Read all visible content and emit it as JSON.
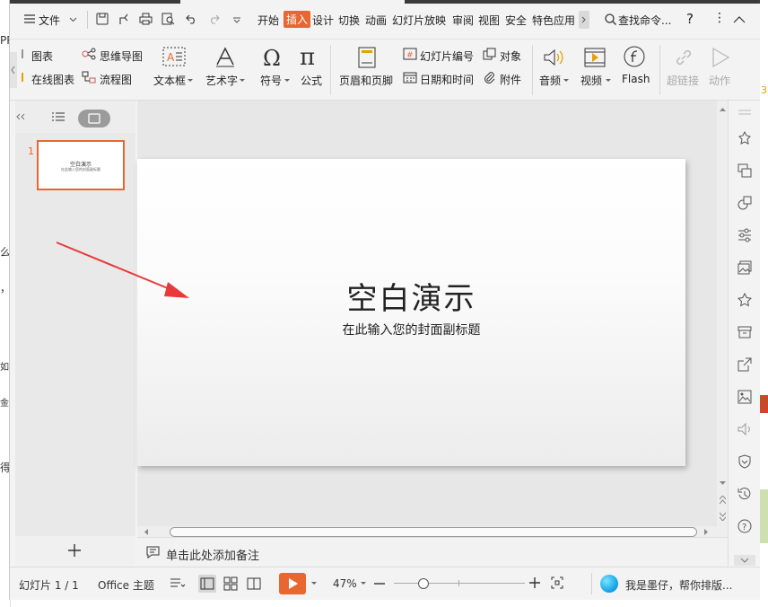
{
  "background_doc": {
    "left_chars": [
      "PP",
      "么",
      "，",
      "如",
      "金",
      "得"
    ],
    "right_char": "3"
  },
  "menu": {
    "file_label": "文件",
    "tabs": [
      "开始",
      "插入",
      "设计",
      "切换",
      "动画",
      "幻灯片放映",
      "审阅",
      "视图",
      "安全",
      "特色应用"
    ],
    "active_tab": "插入",
    "search_label": "查找命令...",
    "help": "?",
    "more": "⋮"
  },
  "ribbon": {
    "chart": "图表",
    "online_chart": "在线图表",
    "mindmap": "思维导图",
    "flowchart": "流程图",
    "textbox": "文本框",
    "wordart": "艺术字",
    "symbol": "符号",
    "formula": "公式",
    "header_footer": "页眉和页脚",
    "slide_number": "幻灯片编号",
    "datetime": "日期和时间",
    "object": "对象",
    "attachment": "附件",
    "audio": "音频",
    "video": "视频",
    "flash": "Flash",
    "hyperlink": "超链接",
    "action": "动作"
  },
  "thumbnails": [
    {
      "number": "1",
      "title": "空白演示",
      "subtitle": "在此输入您的封面副标题"
    }
  ],
  "slide": {
    "title": "空白演示",
    "subtitle": "在此输入您的封面副标题"
  },
  "notes": {
    "placeholder": "单击此处添加备注"
  },
  "status": {
    "slide_info": "幻灯片 1 / 1",
    "theme": "Office 主题",
    "zoom": "47%",
    "zoom_level": 0.2,
    "assistant": "我是墨仔，帮你排版..."
  },
  "colors": {
    "accent": "#e8662f",
    "arrow": "#e83a3a"
  }
}
